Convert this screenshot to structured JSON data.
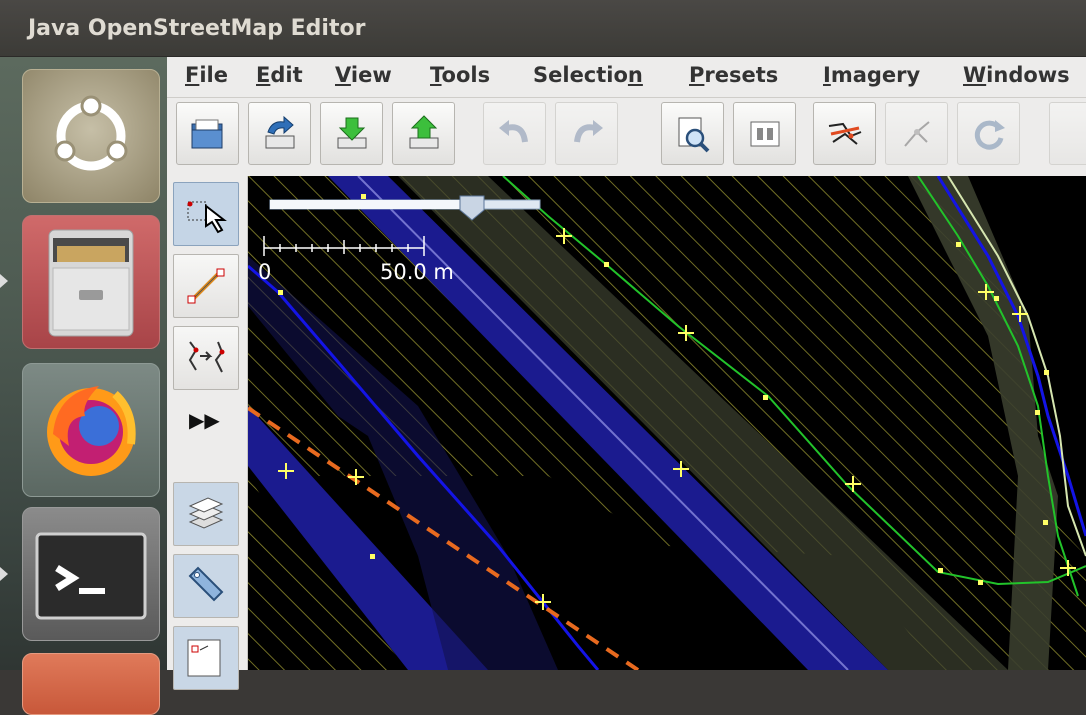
{
  "window": {
    "title": "Java OpenStreetMap Editor"
  },
  "launcher": {
    "items": [
      {
        "icon": "ubuntu-logo-icon"
      },
      {
        "icon": "file-cabinet-icon"
      },
      {
        "icon": "firefox-icon"
      },
      {
        "icon": "terminal-icon"
      },
      {
        "icon": "text-editor-icon"
      }
    ]
  },
  "menubar": {
    "items": [
      {
        "label": "File",
        "mnemonic": "F",
        "rest": "ile"
      },
      {
        "label": "Edit",
        "mnemonic": "E",
        "rest": "dit"
      },
      {
        "label": "View",
        "mnemonic": "V",
        "rest": "iew"
      },
      {
        "label": "Tools",
        "mnemonic": "T",
        "rest": "ools"
      },
      {
        "label": "Selection",
        "pre": "Selectio",
        "mnemonic": "n",
        "rest": ""
      },
      {
        "label": "Presets",
        "mnemonic": "P",
        "rest": "resets"
      },
      {
        "label": "Imagery",
        "mnemonic": "I",
        "rest": "magery"
      },
      {
        "label": "Windows",
        "mnemonic": "W",
        "rest": "indows"
      }
    ]
  },
  "toolbar": {
    "buttons": [
      {
        "icon": "open-file-icon",
        "enabled": true
      },
      {
        "icon": "open-location-icon",
        "enabled": true
      },
      {
        "icon": "download-icon",
        "enabled": true
      },
      {
        "icon": "upload-icon",
        "enabled": true
      },
      {
        "icon": "undo-icon",
        "enabled": false
      },
      {
        "icon": "redo-icon",
        "enabled": false
      },
      {
        "icon": "zoom-preview-icon",
        "enabled": true
      },
      {
        "icon": "preferences-icon",
        "enabled": true
      },
      {
        "icon": "wireframe-icon",
        "enabled": true
      },
      {
        "icon": "split-way-icon",
        "enabled": false
      },
      {
        "icon": "refresh-icon",
        "enabled": false
      }
    ]
  },
  "modes": {
    "items": [
      {
        "icon": "select-mode-icon",
        "selected": true
      },
      {
        "icon": "draw-mode-icon",
        "selected": false
      },
      {
        "icon": "improve-way-icon",
        "selected": false
      },
      {
        "icon": "more-modes-icon",
        "label": "▶▶",
        "selected": false
      },
      {
        "icon": "layers-icon",
        "selected": false
      },
      {
        "icon": "tag-icon",
        "selected": false
      },
      {
        "icon": "relation-icon",
        "selected": false
      }
    ]
  },
  "map": {
    "zoom_slider_fraction": 0.77,
    "scale_bar": {
      "start_label": "0",
      "end_label": "50.0 m"
    },
    "colors": {
      "background": "#000000",
      "hatch": "#8d8a2e",
      "road_highlight": "#1b1b8f",
      "road_line": "#1414e6",
      "footpath": "#22c32a",
      "railway_dash": "#e86a1f",
      "node": "#ffff66"
    }
  }
}
